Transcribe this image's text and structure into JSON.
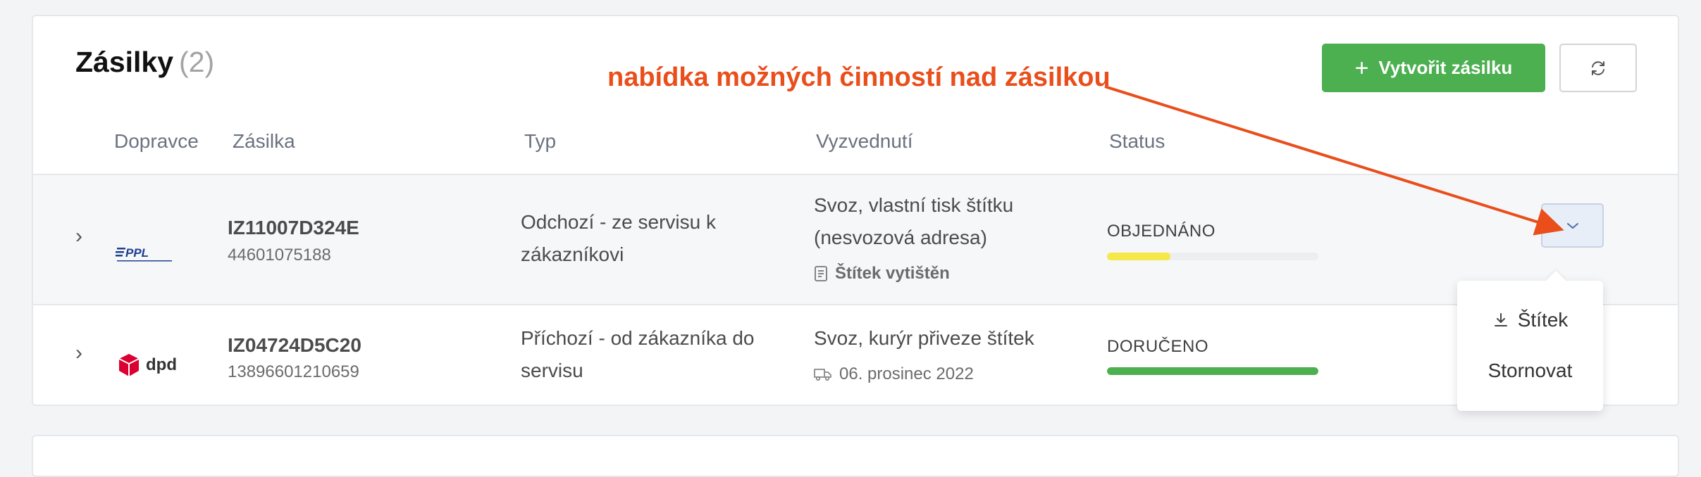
{
  "header": {
    "title": "Zásilky",
    "count": "(2)",
    "annotation": "nabídka možných činností nad zásilkou",
    "create_button": "Vytvořit zásilku",
    "create_icon": "plus-icon",
    "refresh_icon": "refresh-icon"
  },
  "columns": [
    "Dopravce",
    "Zásilka",
    "Typ",
    "Vyzvednutí",
    "Status"
  ],
  "rows": [
    {
      "carrier": "PPL",
      "carrier_icon": "ppl-logo",
      "code": "IZ11007D324E",
      "number": "44601075188",
      "type_line1": "Odchozí - ze servisu k",
      "type_line2": "zákazníkovi",
      "pickup_line1": "Svoz, vlastní tisk štítku",
      "pickup_line2": "(nesvozová adresa)",
      "pickup_sub": "Štítek vytištěn",
      "pickup_sub_icon": "document-icon",
      "status": "OBJEDNÁNO",
      "progress": 0.3,
      "progress_color": "#f7e84a"
    },
    {
      "carrier": "dpd",
      "carrier_icon": "dpd-logo",
      "code": "IZ04724D5C20",
      "number": "13896601210659",
      "type_line1": "Příchozí - od zákazníka do",
      "type_line2": "servisu",
      "pickup_line1": "Svoz, kurýr přiveze štítek",
      "pickup_sub": "06. prosinec 2022",
      "pickup_sub_icon": "truck-icon",
      "status": "DORUČENO",
      "progress": 1.0,
      "progress_color": "#4caf50"
    }
  ],
  "dropdown_menu": {
    "items": [
      "Štítek",
      "Stornovat"
    ],
    "download_icon": "download-icon"
  },
  "colors": {
    "accent_green": "#4caf50",
    "annotation_red": "#e94e1b"
  }
}
